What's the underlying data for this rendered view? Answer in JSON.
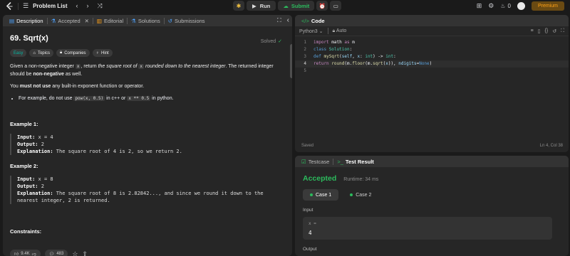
{
  "topbar": {
    "problem_list": "Problem List",
    "run_label": "Run",
    "submit_label": "Submit",
    "streak_count": "0",
    "premium_label": "Premium"
  },
  "left_tabs": [
    "Description",
    "Accepted",
    "Editorial",
    "Solutions",
    "Submissions"
  ],
  "problem": {
    "title": "69. Sqrt(x)",
    "status": "Solved",
    "difficulty": "Easy",
    "chips": [
      "Topics",
      "Companies",
      "Hint"
    ],
    "para1_a": "Given a non-negative integer ",
    "para1_code": "x",
    "para1_b": ", return ",
    "para1_i1": "the square root of ",
    "para1_code2": "x",
    "para1_i2": " rounded down to the nearest integer",
    "para1_c": ". The returned integer should be ",
    "para1_bold": "non-negative",
    "para1_d": " as well.",
    "para2_a": "You ",
    "para2_bold": "must not use",
    "para2_b": " any built-in exponent function or operator.",
    "bullet_a": "For example, do not use ",
    "bullet_code1": "pow(x, 0.5)",
    "bullet_b": " in c++ or ",
    "bullet_code2": "x ** 0.5",
    "bullet_c": " in python.",
    "example1_title": "Example 1:",
    "example1_input_label": "Input:",
    "example1_input": " x = 4",
    "example1_output_label": "Output:",
    "example1_output": " 2",
    "example1_expl_label": "Explanation:",
    "example1_expl": " The square root of 4 is 2, so we return 2.",
    "example2_title": "Example 2:",
    "example2_input_label": "Input:",
    "example2_input": " x = 8",
    "example2_output_label": "Output:",
    "example2_output": " 2",
    "example2_expl_label": "Explanation:",
    "example2_expl1": " The square root of 8 is 2.82842..., and since we round it down to the",
    "example2_expl2": "nearest integer, 2 is returned.",
    "constraints_title": "Constraints:",
    "likes": "9.4K",
    "comments": "483"
  },
  "code_panel": {
    "title": "Code",
    "language": "Python3",
    "auto": "Auto",
    "lines": [
      "import math as m",
      "class Solution:",
      "    def mySqrt(self, x: int) -> int:",
      "        return round(m.floor(m.sqrt(x)), ndigits=None)",
      ""
    ],
    "status": "Saved",
    "cursor": "Ln 4, Col 38"
  },
  "result_panel": {
    "tab_testcase": "Testcase",
    "tab_result": "Test Result",
    "verdict": "Accepted",
    "runtime": "Runtime: 34 ms",
    "case1": "Case 1",
    "case2": "Case 2",
    "input_label": "Input",
    "input_var": "x =",
    "input_value": "4",
    "output_label": "Output"
  },
  "colors": {
    "accent_green": "#2cbb5d",
    "easy": "#00b8a3",
    "premium": "#ffa116"
  }
}
